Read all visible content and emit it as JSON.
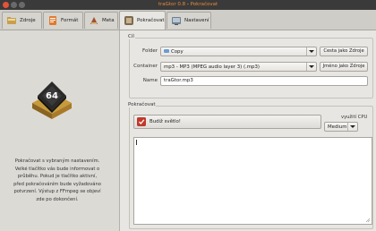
{
  "window": {
    "app_name": "traGtor 0.8",
    "separator": " - ",
    "view_name": "Pokračovat"
  },
  "tabs": [
    {
      "label": "Zdroje",
      "icon": "source-folder-icon"
    },
    {
      "label": "Formát",
      "icon": "format-icon"
    },
    {
      "label": "Meta",
      "icon": "meta-icon"
    },
    {
      "label": "Pokračovat",
      "icon": "proceed-icon"
    },
    {
      "label": "Nastavení",
      "icon": "settings-icon"
    }
  ],
  "left": {
    "chip_text": "64",
    "description": "Pokračovat s vybraným nastavením. Velké tlačítko vás bude informovat o průběhu. Pokud je tlačítko aktivní, před pokračováním bude vyžadováno potvrzení. Výstup z FFmpeg se objeví zde po dokončení."
  },
  "output": {
    "section_label": "Cíl",
    "folder_label": "Folder",
    "folder_value": "Copy",
    "folder_button": "Cesta jako Zdroje",
    "container_label": "Container",
    "container_value": "mp3 - MP3 (MPEG audio layer 3) (.mp3)",
    "container_button": "Jméno jako Zdroje",
    "name_label": "Name",
    "name_value": "traGtor.mp3"
  },
  "proceed": {
    "section_label": "Pokračovat",
    "convert_label": "Budiž světlo!",
    "cpu_label": "využití CPU",
    "cpu_value": "Medium"
  },
  "colors": {
    "accent": "#e88a3a",
    "convert_icon": "#c0392b",
    "close_button": "#e2533a"
  }
}
